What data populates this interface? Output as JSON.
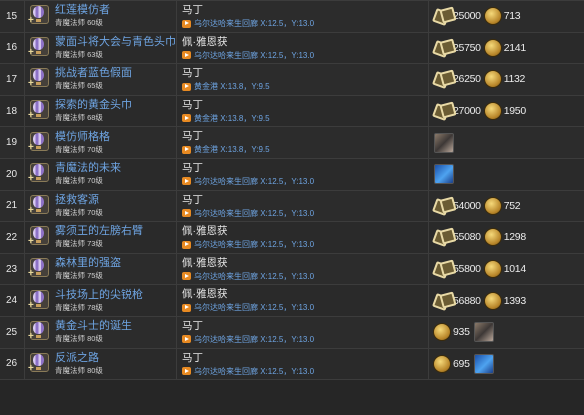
{
  "rows": [
    {
      "num": "15",
      "title": "红莲模仿者",
      "level": "青魔法师 60级",
      "npc": "马丁",
      "loc": "乌尔达哈来生回廊 X:12.5，Y:13.0",
      "rewards": [
        {
          "kind": "crystal",
          "value": "25000"
        },
        {
          "kind": "gil",
          "value": "713"
        }
      ]
    },
    {
      "num": "16",
      "title": "蒙面斗将大会与青色头巾",
      "level": "青魔法师 63级",
      "npc": "佩·雅恩获",
      "loc": "乌尔达哈来生回廊 X:12.5，Y:13.0",
      "rewards": [
        {
          "kind": "crystal",
          "value": "25750"
        },
        {
          "kind": "gil",
          "value": "2141"
        }
      ]
    },
    {
      "num": "17",
      "title": "挑战者蓝色假面",
      "level": "青魔法师 65级",
      "npc": "马丁",
      "loc": "黄金港 X:13.8，Y:9.5",
      "rewards": [
        {
          "kind": "crystal",
          "value": "26250"
        },
        {
          "kind": "gil",
          "value": "1132"
        }
      ]
    },
    {
      "num": "18",
      "title": "探索的黄金头巾",
      "level": "青魔法师 68级",
      "npc": "马丁",
      "loc": "黄金港 X:13.8，Y:9.5",
      "rewards": [
        {
          "kind": "crystal",
          "value": "27000"
        },
        {
          "kind": "gil",
          "value": "1950"
        }
      ]
    },
    {
      "num": "19",
      "title": "模仿师格格",
      "level": "青魔法师 70级",
      "npc": "马丁",
      "loc": "黄金港 X:13.8，Y:9.5",
      "rewards": [
        {
          "kind": "item-wolf",
          "value": ""
        }
      ]
    },
    {
      "num": "20",
      "title": "青魔法的未来",
      "level": "青魔法师 70级",
      "npc": "马丁",
      "loc": "乌尔达哈来生回廊 X:12.5，Y:13.0",
      "rewards": [
        {
          "kind": "item-blue",
          "value": ""
        }
      ]
    },
    {
      "num": "21",
      "title": "拯救客源",
      "level": "青魔法师 70级",
      "npc": "马丁",
      "loc": "乌尔达哈来生回廊 X:12.5，Y:13.0",
      "rewards": [
        {
          "kind": "crystal",
          "value": "54000"
        },
        {
          "kind": "gil",
          "value": "752"
        }
      ]
    },
    {
      "num": "22",
      "title": "雾须王的左膀右臂",
      "level": "青魔法师 73级",
      "npc": "佩·雅恩获",
      "loc": "乌尔达哈来生回廊 X:12.5，Y:13.0",
      "rewards": [
        {
          "kind": "crystal",
          "value": "55080"
        },
        {
          "kind": "gil",
          "value": "1298"
        }
      ]
    },
    {
      "num": "23",
      "title": "森林里的强盗",
      "level": "青魔法师 75级",
      "npc": "佩·雅恩获",
      "loc": "乌尔达哈来生回廊 X:12.5，Y:13.0",
      "rewards": [
        {
          "kind": "crystal",
          "value": "55800"
        },
        {
          "kind": "gil",
          "value": "1014"
        }
      ]
    },
    {
      "num": "24",
      "title": "斗技场上的尖锐枪",
      "level": "青魔法师 78级",
      "npc": "佩·雅恩获",
      "loc": "乌尔达哈来生回廊 X:12.5，Y:13.0",
      "rewards": [
        {
          "kind": "crystal",
          "value": "56880"
        },
        {
          "kind": "gil",
          "value": "1393"
        }
      ]
    },
    {
      "num": "25",
      "title": "黄金斗士的诞生",
      "level": "青魔法师 80级",
      "npc": "马丁",
      "loc": "乌尔达哈来生回廊 X:12.5，Y:13.0",
      "rewards": [
        {
          "kind": "gil",
          "value": "935"
        },
        {
          "kind": "item-wolf",
          "value": ""
        }
      ]
    },
    {
      "num": "26",
      "title": "反派之路",
      "level": "青魔法师 80级",
      "npc": "马丁",
      "loc": "乌尔达哈来生回廊 X:12.5，Y:13.0",
      "rewards": [
        {
          "kind": "gil",
          "value": "695"
        },
        {
          "kind": "item-blue",
          "value": ""
        }
      ]
    }
  ],
  "icons": {
    "job": "blue-mage-job-icon",
    "location": "map-location-icon",
    "crystal": "allagan-tomestone-icon",
    "gil": "gil-coin-icon",
    "item_blue": "blue-item-reward-icon",
    "item_wolf": "wolf-item-reward-icon"
  },
  "colors": {
    "background": "#262626",
    "link": "#6ea4e2",
    "location_badge": "#e88a22",
    "border": "#3c3c3c"
  }
}
